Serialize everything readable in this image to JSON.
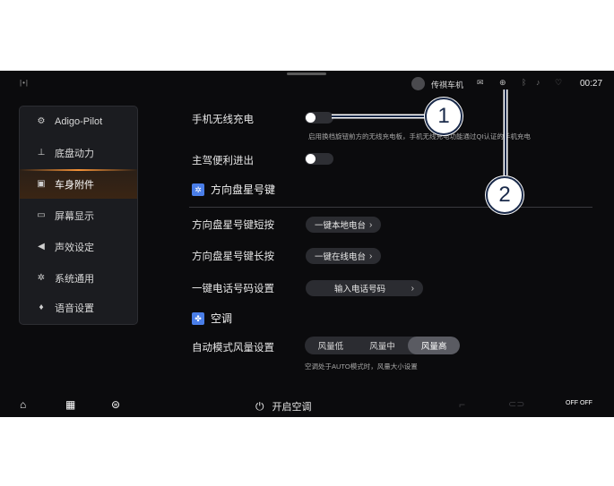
{
  "status_bar": {
    "left_indicator": "|•|",
    "user_name": "传祺车机",
    "time": "00:27",
    "icons": [
      "message-icon",
      "hotspot-icon",
      "bluetooth-icon",
      "mute-icon",
      "wifi-icon"
    ]
  },
  "sidebar": {
    "items": [
      {
        "label": "Adigo-Pilot",
        "icon": "steering-icon",
        "active": false
      },
      {
        "label": "底盘动力",
        "icon": "chassis-icon",
        "active": false
      },
      {
        "label": "车身附件",
        "icon": "car-body-icon",
        "active": true
      },
      {
        "label": "屏幕显示",
        "icon": "monitor-icon",
        "active": false
      },
      {
        "label": "声效设定",
        "icon": "speaker-icon",
        "active": false
      },
      {
        "label": "系统通用",
        "icon": "gear-icon",
        "active": false
      },
      {
        "label": "语音设置",
        "icon": "mic-icon",
        "active": false
      }
    ]
  },
  "main": {
    "wireless_charging": {
      "label": "手机无线充电",
      "enabled": false,
      "hint": "启用换档旋钮前方的无线充电板，手机无线充电功能通过QI认证的手机充电"
    },
    "easy_entry": {
      "label": "主驾便利进出",
      "enabled": false
    },
    "steering_star": {
      "title": "方向盘星号键",
      "short_press": {
        "label": "方向盘星号键短按",
        "value": "一键本地电台"
      },
      "long_press": {
        "label": "方向盘星号键长按",
        "value": "一键在线电台"
      },
      "phone_setting": {
        "label": "一键电话号码设置",
        "value": "输入电话号码"
      }
    },
    "ac": {
      "title": "空调",
      "fan_label": "自动模式风量设置",
      "fan_options": [
        "风量低",
        "风量中",
        "风量高"
      ],
      "fan_selected": "风量高",
      "fan_hint": "空调处于AUTO模式时，风量大小设置"
    }
  },
  "bottom_bar": {
    "ac_button": "开启空调",
    "icons": [
      "home-icon",
      "apps-icon",
      "car-icon",
      "seat-icon",
      "vehicle-outline-icon",
      "off-off-icon"
    ],
    "off_label": "OFF OFF"
  },
  "callouts": [
    "1",
    "2"
  ],
  "colors": {
    "background": "#0b0b0d",
    "accent": "#f39137",
    "section_icon": "#4a7ee8"
  }
}
